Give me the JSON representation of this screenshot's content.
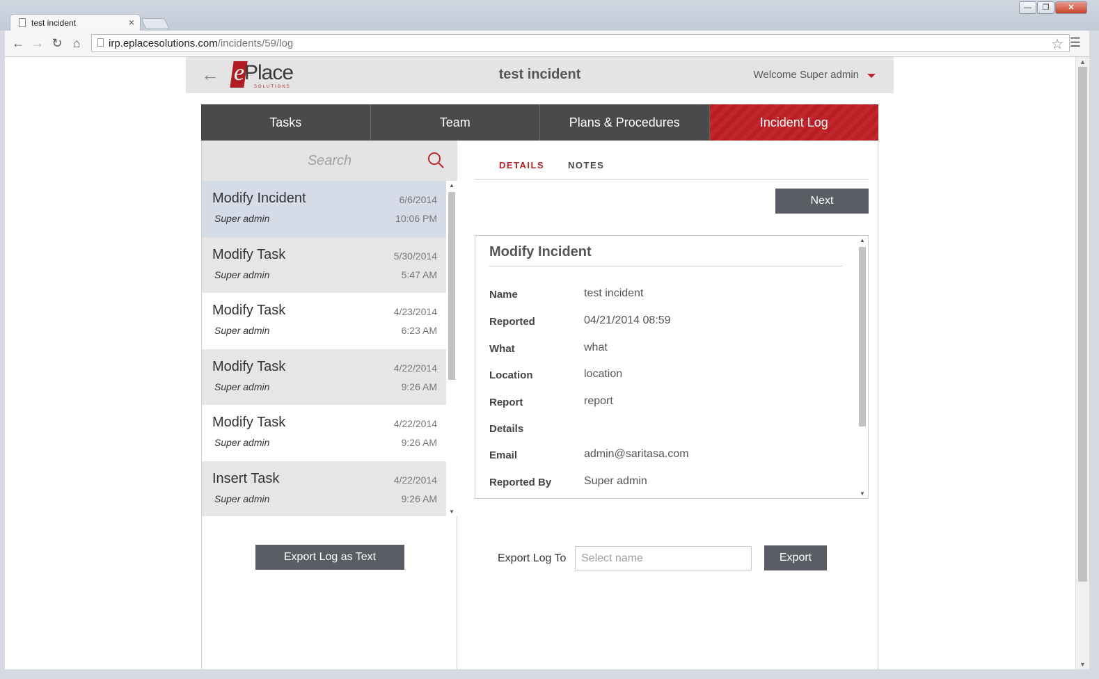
{
  "browser": {
    "tab_title": "test incident",
    "tab_close": "×",
    "url_host": "irp.eplacesolutions.com",
    "url_path": "/incidents/59/log",
    "window_buttons": [
      "—",
      "❐",
      "✕"
    ]
  },
  "header": {
    "logo_text": "Place",
    "logo_e": "e",
    "logo_sub": "SOLUTIONS",
    "title": "test incident",
    "welcome": "Welcome Super admin"
  },
  "main_tabs": [
    {
      "label": "Tasks",
      "active": false
    },
    {
      "label": "Team",
      "active": false
    },
    {
      "label": "Plans & Procedures",
      "active": false
    },
    {
      "label": "Incident Log",
      "active": true
    }
  ],
  "search": {
    "placeholder": "Search"
  },
  "log_items": [
    {
      "title": "Modify Incident",
      "user": "Super admin",
      "date": "6/6/2014",
      "time": "10:06 PM"
    },
    {
      "title": "Modify Task",
      "user": "Super admin",
      "date": "5/30/2014",
      "time": "5:47 AM"
    },
    {
      "title": "Modify Task",
      "user": "Super admin",
      "date": "4/23/2014",
      "time": "6:23 AM"
    },
    {
      "title": "Modify Task",
      "user": "Super admin",
      "date": "4/22/2014",
      "time": "9:26 AM"
    },
    {
      "title": "Modify Task",
      "user": "Super admin",
      "date": "4/22/2014",
      "time": "9:26 AM"
    },
    {
      "title": "Insert Task",
      "user": "Super admin",
      "date": "4/22/2014",
      "time": "9:26 AM"
    }
  ],
  "export_log_text_label": "Export Log as Text",
  "sub_tabs": [
    {
      "label": "DETAILS",
      "active": true
    },
    {
      "label": "NOTES",
      "active": false
    }
  ],
  "next_label": "Next",
  "details": {
    "title": "Modify Incident",
    "rows": [
      {
        "label": "Name",
        "value": "test incident"
      },
      {
        "label": "Reported",
        "value": "04/21/2014 08:59"
      },
      {
        "label": "What",
        "value": "what"
      },
      {
        "label": "Location",
        "value": "location"
      },
      {
        "label": "Report",
        "value": "report"
      },
      {
        "label": "Details",
        "value": ""
      },
      {
        "label": "Email",
        "value": "admin@saritasa.com"
      },
      {
        "label": "Reported By",
        "value": "Super admin"
      }
    ]
  },
  "export": {
    "label": "Export Log To",
    "placeholder": "Select name",
    "button_label": "Export"
  },
  "colors": {
    "accent": "#b81f25",
    "tab_dark": "#4a4a4a",
    "button_dark": "#5a5d63",
    "selected_row": "#d5dce8"
  }
}
